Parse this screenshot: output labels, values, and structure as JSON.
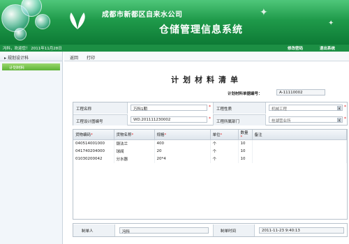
{
  "header": {
    "company": "成都市新都区自来水公司",
    "system_title": "仓储管理信息系统"
  },
  "statusbar": {
    "welcome": "冯科，欢迎您！ 2011年11月28日",
    "change_password": "修改密码",
    "logout": "退出系统"
  },
  "sidebar": {
    "section": "规划设计科",
    "items": [
      {
        "label": "计划材料"
      }
    ]
  },
  "toolbar": {
    "back": "返回",
    "print": "打印"
  },
  "document": {
    "title": "计划材料清单",
    "number_label": "计划材料单据编号：",
    "number_value": "A-11110002"
  },
  "form": {
    "project_name_label": "工程名称",
    "project_name_value": "万科1期",
    "project_type_label": "工程性质",
    "project_type_value": "机械工程",
    "design_no_label": "工程设计图编号",
    "design_no_value": "WD.201111230002",
    "department_label": "工程所属部门",
    "department_value": "桂湖营业所"
  },
  "table": {
    "columns": [
      "货物编码",
      "货物名称",
      "规格",
      "单位",
      "数量",
      "备注"
    ],
    "required_columns": [
      true,
      true,
      true,
      true,
      true,
      false
    ],
    "rows": [
      [
        "040514001000",
        "钢法兰",
        "400",
        "个",
        "10",
        ""
      ],
      [
        "041740204000",
        "球阀",
        "20",
        "个",
        "10",
        ""
      ],
      [
        "01030200042",
        "分水器",
        "20*4",
        "个",
        "10",
        ""
      ]
    ]
  },
  "footer": {
    "creator_label": "制单人",
    "creator_value": "冯科",
    "time_label": "制单时间",
    "time_value": "2011-11-23 9:40:13"
  },
  "colors": {
    "banner_green": "#1f9a4a",
    "required_red": "#e02020"
  }
}
